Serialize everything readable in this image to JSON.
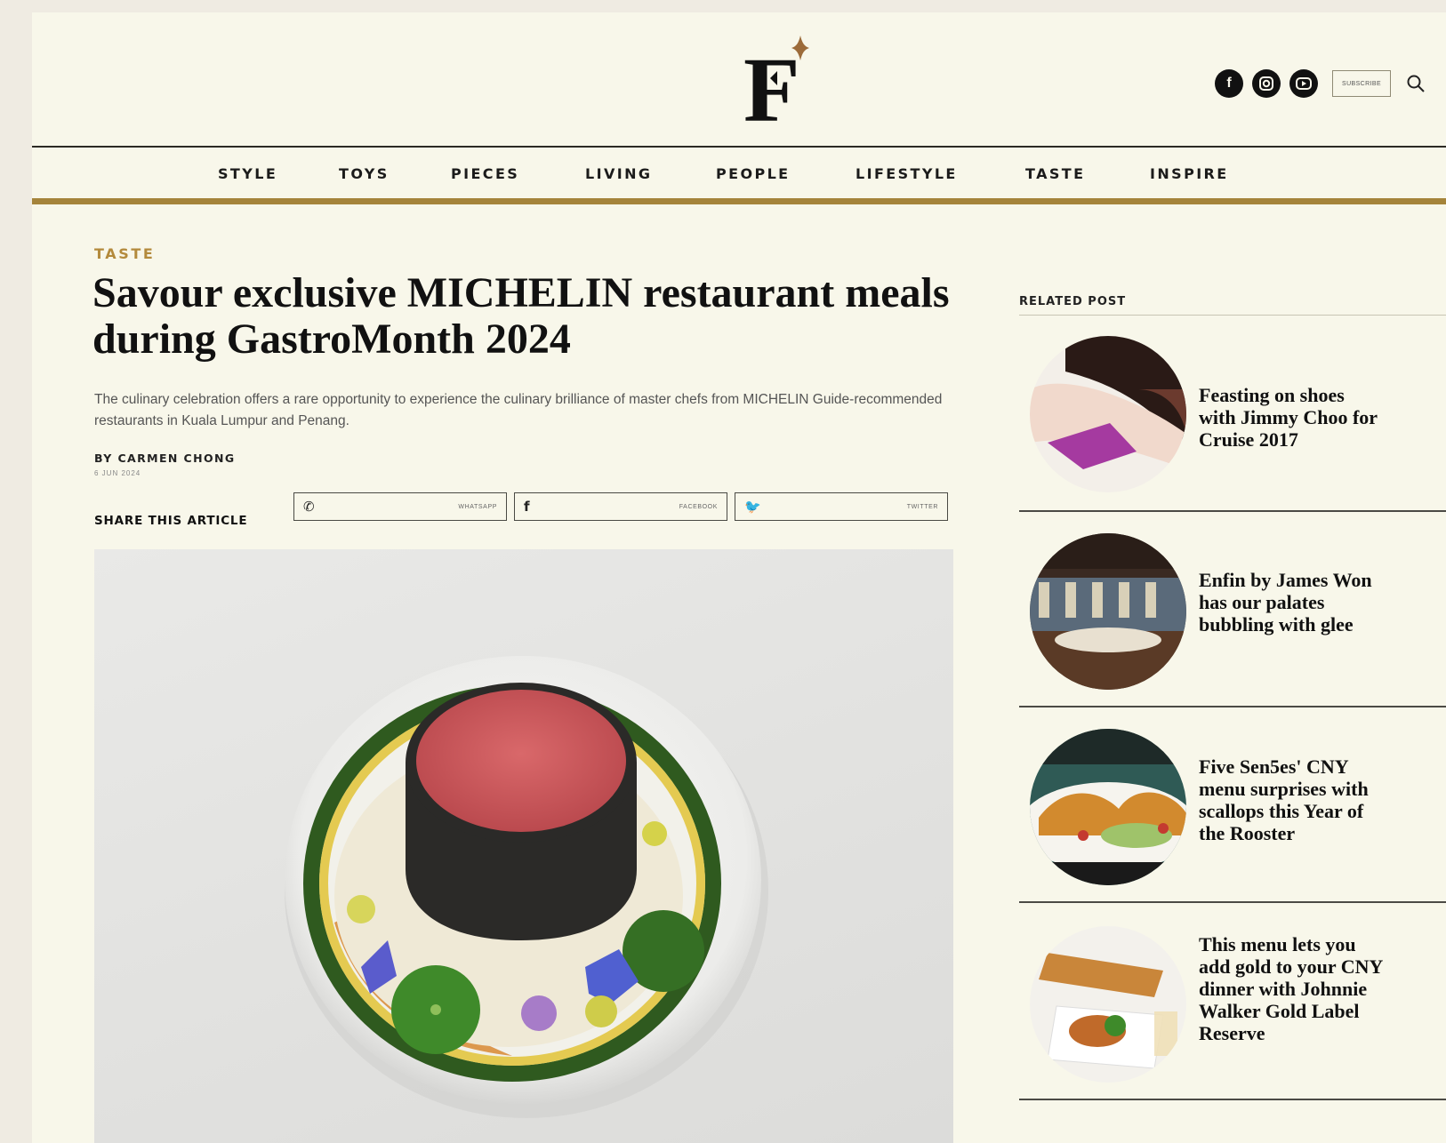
{
  "brand": {
    "logo_letter": "F",
    "accent_color": "#a5843b"
  },
  "header": {
    "social_icons": [
      "facebook-icon",
      "instagram-icon",
      "youtube-icon"
    ],
    "subscribe_label": "SUBSCRIBE",
    "search_icon": "search-icon"
  },
  "nav": {
    "items": [
      "STYLE",
      "TOYS",
      "PIECES",
      "LIVING",
      "PEOPLE",
      "LIFESTYLE",
      "TASTE",
      "INSPIRE"
    ]
  },
  "article": {
    "category": "TASTE",
    "headline": "Savour exclusive MICHELIN restaurant meals during GastroMonth 2024",
    "standfirst": "The culinary celebration offers a rare opportunity to experience the culinary brilliance of master chefs from MICHELIN Guide-recommended restaurants in Kuala Lumpur and Penang.",
    "byline": "BY CARMEN CHONG",
    "date": "6 JUN 2024",
    "share_label": "SHARE THIS ARTICLE",
    "share_buttons": [
      {
        "icon": "whatsapp-icon",
        "glyph": "✆",
        "label": "WHATSAPP"
      },
      {
        "icon": "facebook-icon",
        "glyph": "f",
        "label": "FACEBOOK"
      },
      {
        "icon": "twitter-icon",
        "glyph": "🐦",
        "label": "TWITTER"
      }
    ]
  },
  "sidebar": {
    "title": "RELATED POST",
    "posts": [
      {
        "title": "Feasting on shoes with Jimmy Choo for Cruise 2017"
      },
      {
        "title": "Enfin by James Won has our palates bubbling with glee"
      },
      {
        "title": "Five Sen5es' CNY menu surprises with scallops this Year of the Rooster"
      },
      {
        "title": "This menu lets you add gold to your CNY dinner with Johnnie Walker Gold Label Reserve"
      }
    ]
  }
}
